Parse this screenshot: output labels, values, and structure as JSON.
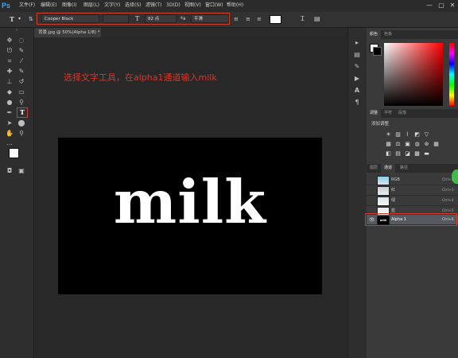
{
  "app": {
    "logo": "Ps"
  },
  "menu": [
    "文件(F)",
    "编辑(E)",
    "图像(I)",
    "图层(L)",
    "文字(Y)",
    "选择(S)",
    "滤镜(T)",
    "3D(D)",
    "视图(V)",
    "窗口(W)",
    "帮助(H)"
  ],
  "window_controls": {
    "minimize": "—",
    "maximize": "▢",
    "close": "✕"
  },
  "options_bar": {
    "font_family": "Cooper Black",
    "font_style": "",
    "font_size": "82 点",
    "anti_alias": "平滑",
    "size_icon": "T",
    "aa_icon": "ªa"
  },
  "document": {
    "tab_title": "背景.jpg @ 50%(Alpha 1/8) *",
    "close_icon": "×",
    "instruction": "选择文字工具，在alpha1通道输入milk",
    "canvas_text": "milk"
  },
  "panels": {
    "color_tabs": [
      "颜色",
      "色板"
    ],
    "adjust_tabs": [
      "调整",
      "字符",
      "段落"
    ],
    "adjust_title": "添加调整",
    "channel_tabs": [
      "图层",
      "通道",
      "路径"
    ],
    "channels": [
      {
        "name": "RGB",
        "shortcut": "Ctrl+2",
        "visible": false
      },
      {
        "name": "红",
        "shortcut": "Ctrl+3",
        "visible": false
      },
      {
        "name": "绿",
        "shortcut": "Ctrl+4",
        "visible": false
      },
      {
        "name": "蓝",
        "shortcut": "Ctrl+5",
        "visible": false
      },
      {
        "name": "Alpha 1",
        "shortcut": "Ctrl+6",
        "visible": true
      }
    ]
  },
  "colors": {
    "accent_red": "#d63a2a",
    "ps_blue": "#31a8ff",
    "foreground": "#ffffff",
    "background": "#000000"
  }
}
